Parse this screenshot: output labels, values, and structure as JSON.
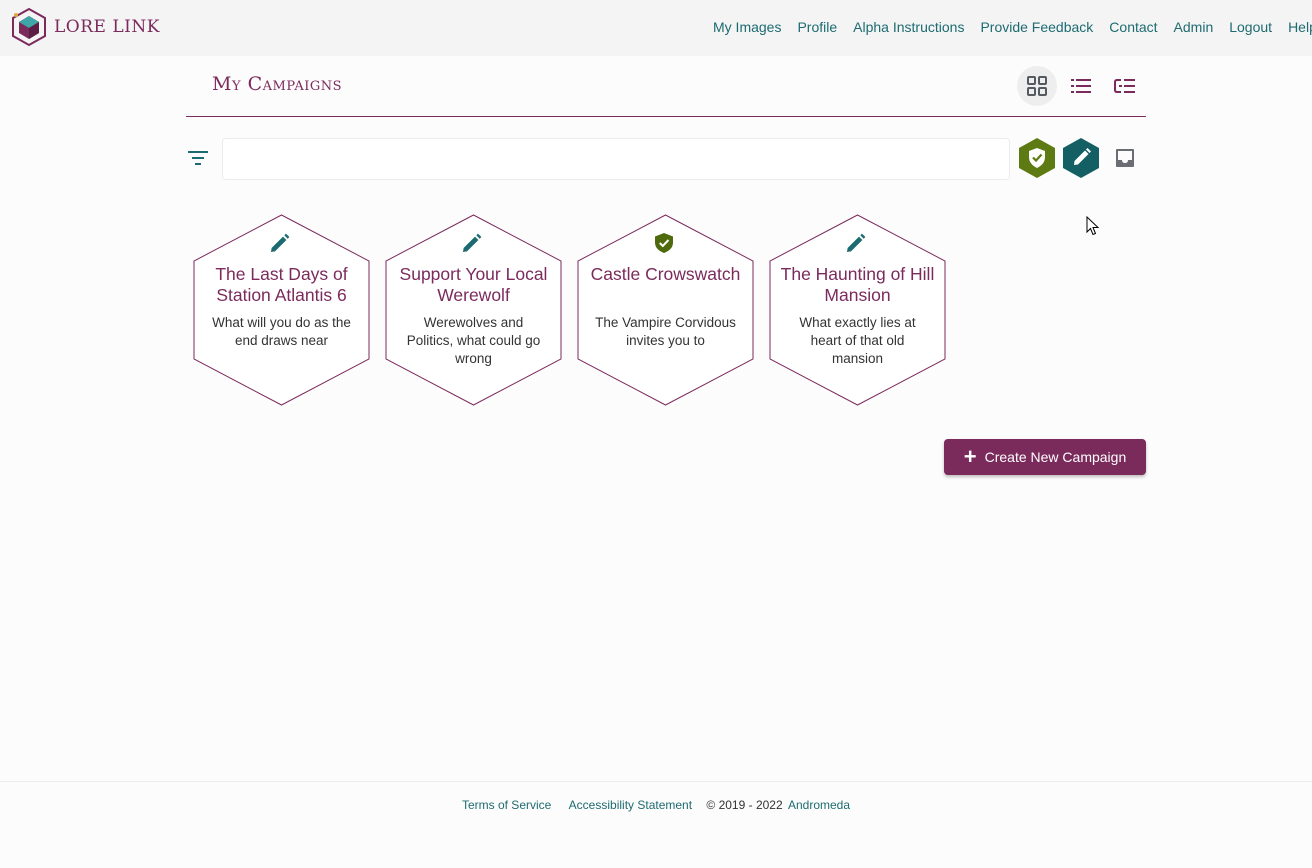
{
  "brand": {
    "name": "LORE LINK"
  },
  "nav": {
    "links": [
      "My Images",
      "Profile",
      "Alpha Instructions",
      "Provide Feedback",
      "Contact",
      "Admin",
      "Logout",
      "Help"
    ]
  },
  "page": {
    "title": "My Campaigns"
  },
  "view_toggle": {
    "icons": [
      "grid-icon",
      "list-icon",
      "hierarchy-list-icon"
    ],
    "active": "grid"
  },
  "filter": {
    "search_value": "",
    "status_icons": [
      "shield-check-icon",
      "pencil-icon",
      "inbox-icon"
    ]
  },
  "campaigns": [
    {
      "title": "The Last Days of Station Atlantis 6",
      "description": "What will you do as the end draws near",
      "status_icon": "pencil-icon"
    },
    {
      "title": "Support Your Local Werewolf",
      "description": "Werewolves and Politics, what could go wrong",
      "status_icon": "pencil-icon"
    },
    {
      "title": "Castle Crowswatch",
      "description": "The Vampire Corvidous invites you to",
      "status_icon": "shield-check-icon"
    },
    {
      "title": "The Haunting of Hill Mansion",
      "description": "What exactly lies at heart of that old mansion",
      "status_icon": "pencil-icon"
    }
  ],
  "actions": {
    "create_label": "Create New Campaign"
  },
  "footer": {
    "terms": "Terms of Service",
    "accessibility": "Accessibility Statement",
    "copyright": "© 2019 - 2022",
    "company": "Andromeda"
  },
  "colors": {
    "brand": "#7b2a5c",
    "teal": "#1d6b70",
    "olive": "#5e7a12",
    "dark_teal": "#145f63"
  }
}
